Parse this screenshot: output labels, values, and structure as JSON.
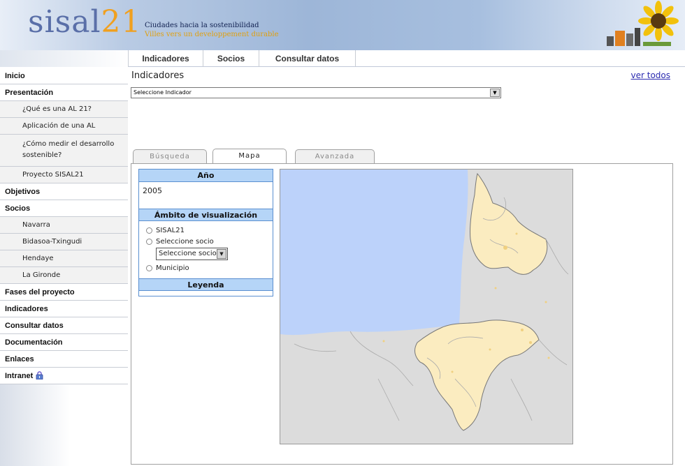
{
  "header": {
    "logo_word": "sisal",
    "logo_number": "21",
    "tagline_es": "Ciudades hacia la sostenibilidad",
    "tagline_fr": "Villes vers un developpement durable"
  },
  "topnav": [
    "Indicadores",
    "Socios",
    "Consultar datos"
  ],
  "sidebar": [
    {
      "label": "Inicio",
      "type": "main"
    },
    {
      "label": "Presentación",
      "type": "main"
    },
    {
      "label": "¿Qué es una AL 21?",
      "type": "sub"
    },
    {
      "label": "Aplicación de una AL",
      "type": "sub"
    },
    {
      "label": "¿Cómo medir el desarrollo sostenible?",
      "type": "sub"
    },
    {
      "label": "Proyecto SISAL21",
      "type": "sub"
    },
    {
      "label": "Objetivos",
      "type": "main"
    },
    {
      "label": "Socios",
      "type": "main"
    },
    {
      "label": "Navarra",
      "type": "sub"
    },
    {
      "label": "Bidasoa-Txingudi",
      "type": "sub"
    },
    {
      "label": "Hendaye",
      "type": "sub"
    },
    {
      "label": "La Gironde",
      "type": "sub"
    },
    {
      "label": "Fases del proyecto",
      "type": "main"
    },
    {
      "label": "Indicadores",
      "type": "main"
    },
    {
      "label": "Consultar datos",
      "type": "main"
    },
    {
      "label": "Documentación",
      "type": "main"
    },
    {
      "label": "Enlaces",
      "type": "main"
    },
    {
      "label": "Intranet",
      "type": "main",
      "icon": "lock-icon"
    }
  ],
  "main": {
    "title": "Indicadores",
    "ver_todos": "ver todos",
    "indicator_select": "Seleccione Indicador",
    "tabs": [
      {
        "label": "Búsqueda",
        "active": false
      },
      {
        "label": "Mapa",
        "active": true
      },
      {
        "label": "Avanzada",
        "active": false
      }
    ],
    "year_header": "Año",
    "year_value": "2005",
    "scope_header": "Ámbito de visualización",
    "options": {
      "sisal": "SISAL21",
      "socio": "Seleccione socio",
      "municipio": "Municipio"
    },
    "socio_select": "Seleccione socio",
    "legend_header": "Leyenda"
  },
  "colors": {
    "sea": "#bcd2fa",
    "region_fill": "#fbecc0",
    "land": "#dcdcdc",
    "box_header": "#b5d5f7",
    "link": "#2b2bb0"
  }
}
